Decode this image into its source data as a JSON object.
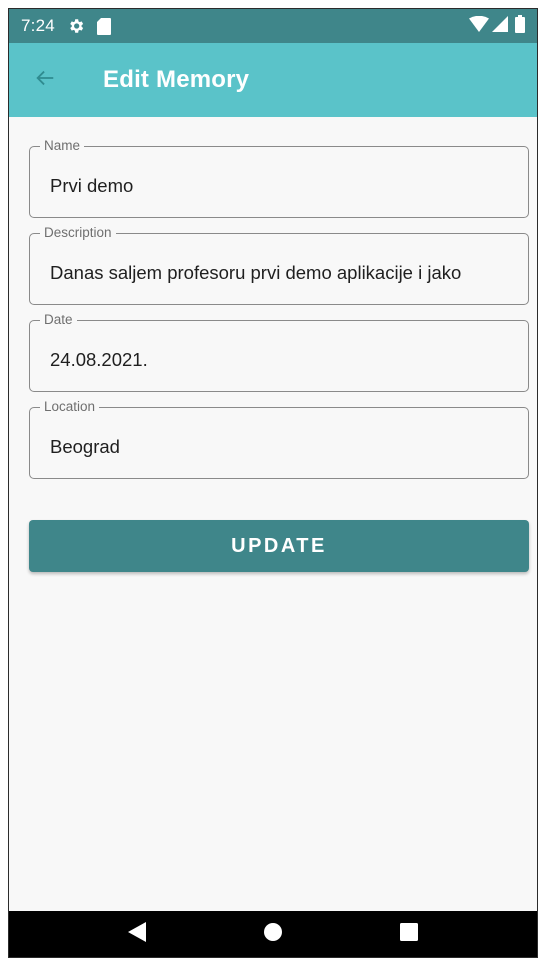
{
  "status_bar": {
    "time": "7:24",
    "icons": [
      "gear-icon",
      "sd-card-icon",
      "wifi-icon",
      "signal-icon",
      "battery-icon"
    ]
  },
  "app_bar": {
    "title": "Edit Memory",
    "back_icon": "arrow-back-icon"
  },
  "form": {
    "fields": [
      {
        "label": "Name",
        "value": "Prvi demo"
      },
      {
        "label": "Description",
        "value": "Danas saljem profesoru prvi demo aplikacije i jako"
      },
      {
        "label": "Date",
        "value": "24.08.2021."
      },
      {
        "label": "Location",
        "value": "Beograd"
      }
    ],
    "update_label": "UPDATE"
  },
  "nav_bar": {
    "icons": [
      "back-triangle-icon",
      "home-circle-icon",
      "recents-square-icon"
    ]
  },
  "colors": {
    "status_bar": "#3f868a",
    "app_bar": "#5ac3c9",
    "button": "#3f868a",
    "background": "#f8f8f8"
  }
}
